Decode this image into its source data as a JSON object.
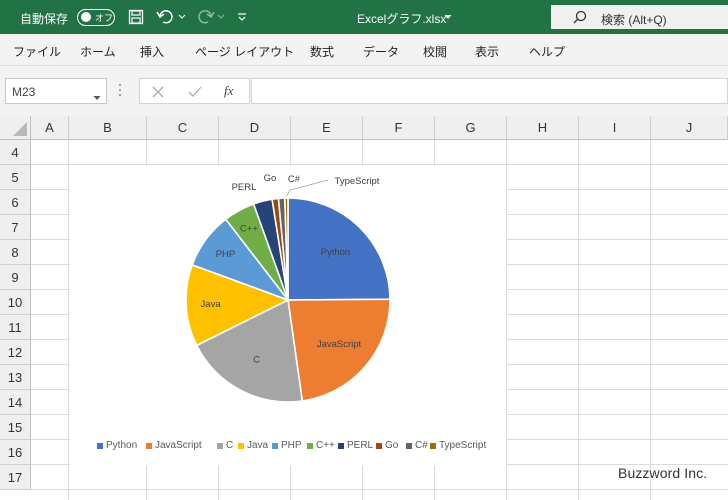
{
  "titlebar": {
    "autosave_label": "自動保存",
    "autosave_state": "オフ",
    "file_title": "Excelグラフ.xlsx",
    "search_text": "検索 (Alt+Q)"
  },
  "ribbon": {
    "tabs": [
      "ファイル",
      "ホーム",
      "挿入",
      "ページ レイアウト",
      "数式",
      "データ",
      "校閲",
      "表示",
      "ヘルプ"
    ]
  },
  "formula_bar": {
    "name_box": "M23",
    "fx": "fx",
    "formula": ""
  },
  "grid": {
    "columns": [
      "A",
      "B",
      "C",
      "D",
      "E",
      "F",
      "G",
      "H",
      "I",
      "J"
    ],
    "rows": [
      "4",
      "5",
      "6",
      "7",
      "8",
      "9",
      "10",
      "11",
      "12",
      "13",
      "14",
      "15",
      "16",
      "17"
    ]
  },
  "chart_data": {
    "type": "pie",
    "title": "",
    "categories": [
      "Python",
      "JavaScript",
      "C",
      "Java",
      "PHP",
      "C++",
      "PERL",
      "Go",
      "C#",
      "TypeScript"
    ],
    "values": [
      25,
      23,
      20,
      13,
      9,
      5,
      3,
      1,
      1,
      0.5
    ],
    "colors": [
      "#4472C4",
      "#ED7D31",
      "#A5A5A5",
      "#FFC000",
      "#5B9BD5",
      "#70AD47",
      "#264478",
      "#9E480E",
      "#636363",
      "#997300"
    ],
    "legend": "bottom",
    "data_labels": "category"
  },
  "watermark": "Buzzword Inc."
}
